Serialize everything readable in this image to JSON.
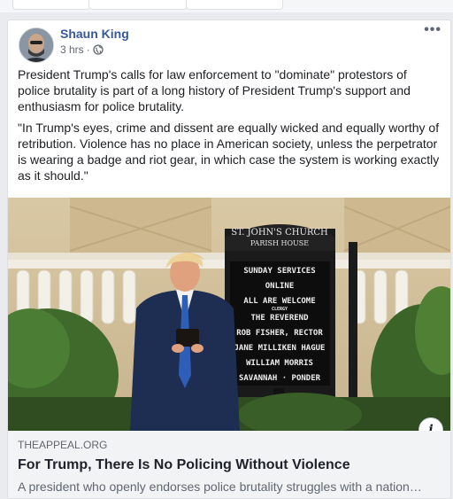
{
  "post": {
    "author": "Shaun King",
    "time": "3 hrs",
    "separator": "·",
    "paragraph_1": "President Trump's calls for law enforcement to \"dominate\" protestors of police brutality is part of a long history of President Trump's support and enthusiasm for police brutality.",
    "paragraph_2": "\"In Trump's eyes, crime and dissent are equally wicked and equally worthy of retribution. Violence has no place in American society, unless the perpetrator is wearing a badge and riot gear, in which case the system is working exactly as it should.\"",
    "more_label": "•••",
    "privacy_icon": "globe-icon"
  },
  "photo": {
    "sign_header_1": "ST. JOHN'S CHURCH",
    "sign_header_2": "PARISH HOUSE",
    "sign_lines": [
      "SUNDAY SERVICES",
      "ONLINE",
      "ALL ARE WELCOME",
      "CLERGY",
      "THE REVEREND",
      "ROB FISHER, RECTOR",
      "JANE MILLIKEN HAGUE",
      "WILLIAM MORRIS",
      "SAVANNAH · PONDER"
    ]
  },
  "link": {
    "domain": "THEAPPEAL.ORG",
    "title": "For Trump, There Is No Policing Without Violence",
    "description": "A president who openly endorses police brutality struggles with a nation…",
    "info_label": "i"
  },
  "colors": {
    "author": "#365899",
    "link_bg": "#f2f3f5",
    "page_bg": "#e9ebee"
  }
}
